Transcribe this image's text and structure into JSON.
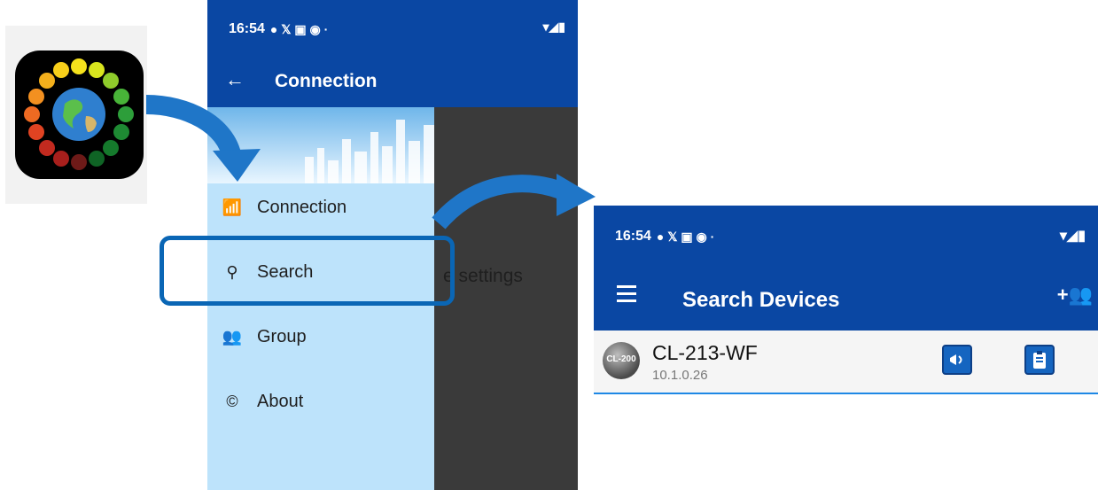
{
  "phone1": {
    "status": {
      "time": "16:54"
    },
    "appbar": {
      "back_icon": "arrow-left-icon",
      "title": "Connection"
    },
    "drawer": {
      "items": [
        {
          "label": "Connection",
          "icon": "remote-icon"
        },
        {
          "label": "Search",
          "icon": "search-icon"
        },
        {
          "label": "Group",
          "icon": "people-icon"
        },
        {
          "label": "About",
          "icon": "copyright-icon"
        }
      ]
    },
    "background_text": "e settings"
  },
  "phone2": {
    "status": {
      "time": "16:54"
    },
    "appbar": {
      "title": "Search Devices"
    },
    "devices": [
      {
        "badge": "CL-200",
        "name": "CL-213-WF",
        "ip": "10.1.0.26"
      }
    ]
  },
  "colors": {
    "appbar": "#0a47a3",
    "drawer": "#bde3fb",
    "highlight": "#0a66b5"
  }
}
